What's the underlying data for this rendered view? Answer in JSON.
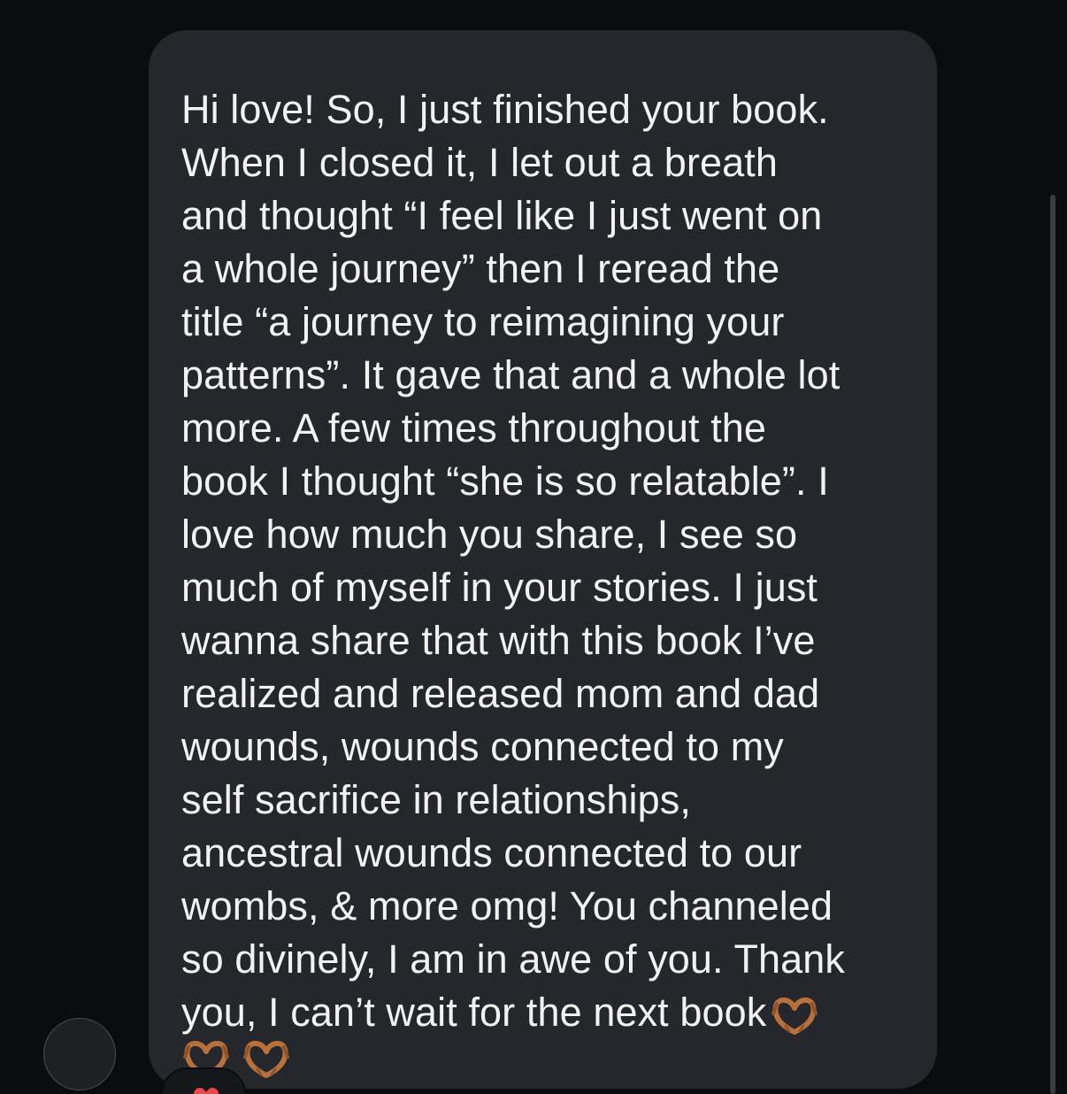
{
  "message": {
    "lines": [
      "Hi love! So, I just finished your book.",
      "When I closed it, I let out a breath",
      "and thought “I feel like I just went on",
      "a whole journey” then I reread the",
      "title “a journey to reimagining your",
      "patterns”. It gave that and a whole lot",
      "more. A few times throughout the",
      "book I thought “she is so relatable”. I",
      "love how much you share, I see so",
      "much of myself in your stories. I just",
      "wanna share that with this book I’ve",
      "realized and released mom and dad",
      "wounds, wounds connected to my",
      "self sacrifice in relationships,",
      "ancestral wounds connected to our",
      "wombs, & more omg! You channeled",
      "so divinely, I am in awe of you. Thank",
      "you, I can’t wait for the next book"
    ],
    "trailing_emoji": "heart-hands-icon",
    "emoji_row": [
      "heart-hands-icon",
      "heart-hands-icon"
    ]
  },
  "reaction": {
    "icon": "heart-icon",
    "color": "#e8474c"
  },
  "colors": {
    "background": "#0b0c10",
    "bubble": "#25272d",
    "text": "#f2f2f4",
    "emoji_skin": "#b8713c"
  }
}
